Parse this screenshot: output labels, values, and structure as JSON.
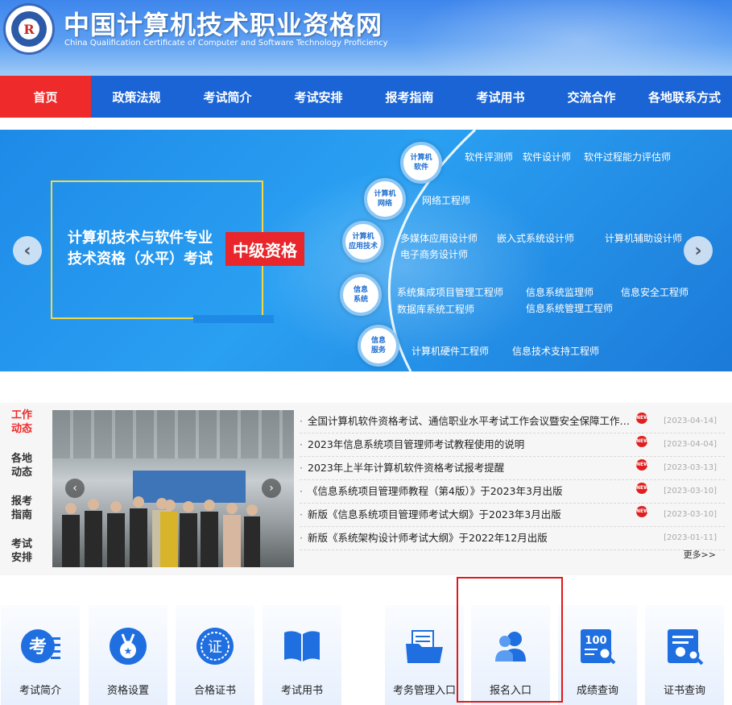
{
  "header": {
    "logo_text": "R",
    "title": "中国计算机技术职业资格网",
    "subtitle": "China Qualification Certificate of Computer and Software Technology Proficiency"
  },
  "nav": {
    "items": [
      "首页",
      "政策法规",
      "考试简介",
      "考试安排",
      "报考指南",
      "考试用书",
      "交流合作",
      "各地联系方式"
    ]
  },
  "banner": {
    "headline_line1": "计算机技术与软件专业",
    "headline_line2": "技术资格（水平）考试",
    "badge": "中级资格",
    "prev_arrow": "‹",
    "next_arrow": "›",
    "nodes": [
      {
        "label1": "计算机",
        "label2": "软件"
      },
      {
        "label1": "计算机",
        "label2": "网络"
      },
      {
        "label1": "计算机",
        "label2": "应用技术"
      },
      {
        "label1": "信息",
        "label2": "系统"
      },
      {
        "label1": "信息",
        "label2": "服务"
      }
    ],
    "jobs": {
      "software": [
        "软件评测师",
        "软件设计师",
        "软件过程能力评估师"
      ],
      "network": [
        "网络工程师"
      ],
      "application": [
        "多媒体应用设计师",
        "嵌入式系统设计师",
        "计算机辅助设计师",
        "电子商务设计师"
      ],
      "system": [
        "系统集成项目管理工程师",
        "信息系统监理师",
        "信息安全工程师",
        "数据库系统工程师",
        "信息系统管理工程师"
      ],
      "service": [
        "计算机硬件工程师",
        "信息技术支持工程师"
      ]
    }
  },
  "news": {
    "tabs": [
      {
        "line1": "工作",
        "line2": "动态"
      },
      {
        "line1": "各地",
        "line2": "动态"
      },
      {
        "line1": "报考",
        "line2": "指南"
      },
      {
        "line1": "考试",
        "line2": "安排"
      }
    ],
    "photo_prev": "‹",
    "photo_next": "›",
    "new_badge": "NEW",
    "items": [
      {
        "text": "全国计算机软件资格考试、通信职业水平考试工作会议暨安全保障工作会在...",
        "date": "[2023-04-14]",
        "new": true
      },
      {
        "text": "2023年信息系统项目管理师考试教程使用的说明",
        "date": "[2023-04-04]",
        "new": true
      },
      {
        "text": "2023年上半年计算机软件资格考试报考提醒",
        "date": "[2023-03-13]",
        "new": true
      },
      {
        "text": "《信息系统项目管理师教程（第4版）》于2023年3月出版",
        "date": "[2023-03-10]",
        "new": true
      },
      {
        "text": "新版《信息系统项目管理师考试大纲》于2023年3月出版",
        "date": "[2023-03-10]",
        "new": true
      },
      {
        "text": "新版《系统架构设计师考试大纲》于2022年12月出版",
        "date": "[2023-01-11]",
        "new": false
      }
    ],
    "more": "更多>>"
  },
  "quick_links": [
    {
      "label": "考试简介",
      "icon": "exam-intro-icon"
    },
    {
      "label": "资格设置",
      "icon": "medal-icon"
    },
    {
      "label": "合格证书",
      "icon": "certificate-seal-icon"
    },
    {
      "label": "考试用书",
      "icon": "book-icon"
    },
    {
      "label": "考务管理入口",
      "icon": "folder-icon"
    },
    {
      "label": "报名入口",
      "icon": "users-icon"
    },
    {
      "label": "成绩查询",
      "icon": "score-search-icon"
    },
    {
      "label": "证书查询",
      "icon": "certificate-search-icon"
    }
  ],
  "colors": {
    "nav_bg": "#1a64d6",
    "nav_active": "#ee2a2a",
    "icon_blue": "#1f6fe0",
    "highlight": "#e01818"
  }
}
